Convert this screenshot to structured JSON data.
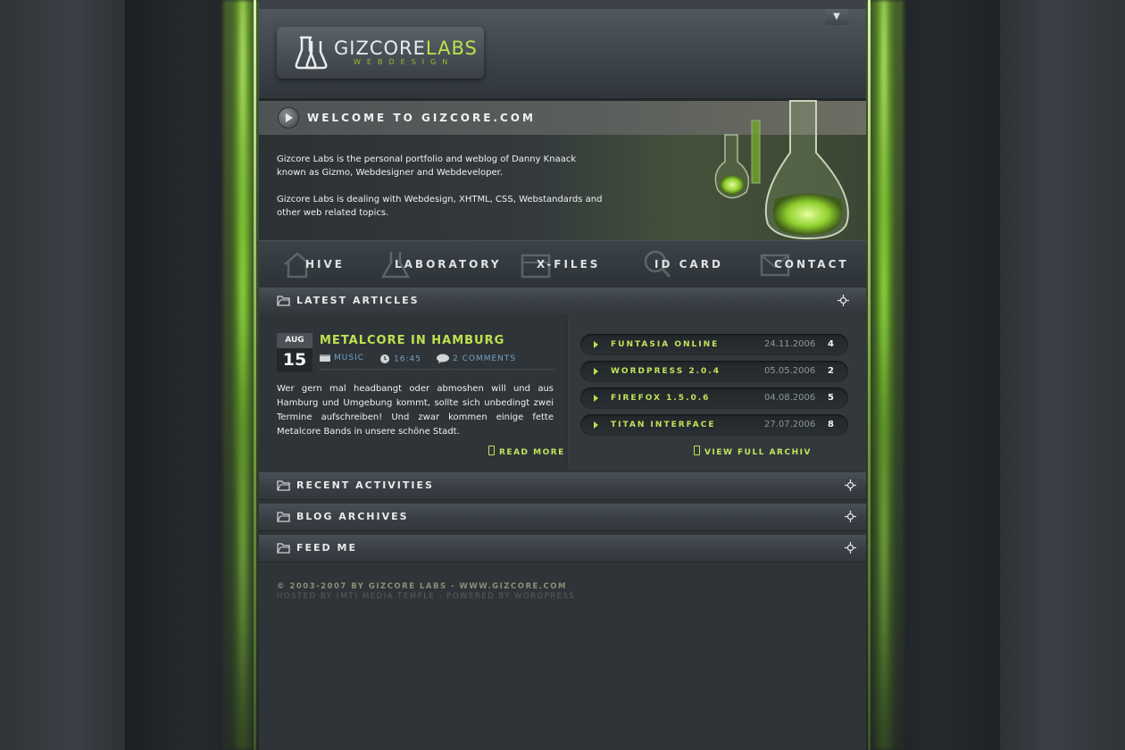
{
  "header": {
    "logo_part1": "GIZCORE",
    "logo_part2": "LABS",
    "logo_sub": "WEBDESIGN"
  },
  "welcome": {
    "title": "WELCOME TO GIZCORE.COM",
    "paragraphs": [
      "Gizcore Labs is the personal portfolio and weblog of Danny Knaack known as Gizmo, Webdesigner and Webdeveloper.",
      "Gizcore Labs is dealing with Webdesign, XHTML, CSS, Webstandards and other web related topics."
    ]
  },
  "nav": {
    "items": [
      {
        "label": "HIVE",
        "icon": "home-icon"
      },
      {
        "label": "LABORATORY",
        "icon": "flask-icon"
      },
      {
        "label": "X-FILES",
        "icon": "folder-box-icon"
      },
      {
        "label": "ID CARD",
        "icon": "magnifier-icon"
      },
      {
        "label": "CONTACT",
        "icon": "envelope-icon"
      }
    ]
  },
  "sections": {
    "latest_articles": "LATEST ARTICLES",
    "recent_activities": "RECENT ACTIVITIES",
    "blog_archives": "BLOG ARCHIVES",
    "feed_me": "FEED ME"
  },
  "post": {
    "month": "AUG",
    "day": "15",
    "title": "METALCORE IN HAMBURG",
    "category": "MUSIC",
    "time": "16:45",
    "comments": "2 COMMENTS",
    "body": "Wer gern mal headbangt oder abmoshen will und aus Hamburg und Umgebung kommt, sollte sich unbedingt zwei Termine aufschreiben! Und zwar kommen einige fette Metalcore Bands in unsere schöne Stadt.",
    "read_more": "READ MORE"
  },
  "archive": {
    "items": [
      {
        "title": "FUNTASIA ONLINE",
        "date": "24.11.2006",
        "count": "4"
      },
      {
        "title": "WORDPRESS 2.0.4",
        "date": "05.05.2006",
        "count": "2"
      },
      {
        "title": "FIREFOX 1.5.0.6",
        "date": "04.08.2006",
        "count": "5"
      },
      {
        "title": "TITAN INTERFACE",
        "date": "27.07.2006",
        "count": "8"
      }
    ],
    "view_full": "VIEW FULL ARCHIV"
  },
  "footer": {
    "line1": "© 2003-2007 BY GIZCORE LABS - WWW.GIZCORE.COM",
    "line2": "HOSTED BY (MT) MEDIA TEMPLE - POWERED BY WORDPRESS"
  },
  "colors": {
    "accent_green": "#bde34f",
    "link_blue": "#6fa3c7",
    "background": "#2f3438"
  }
}
